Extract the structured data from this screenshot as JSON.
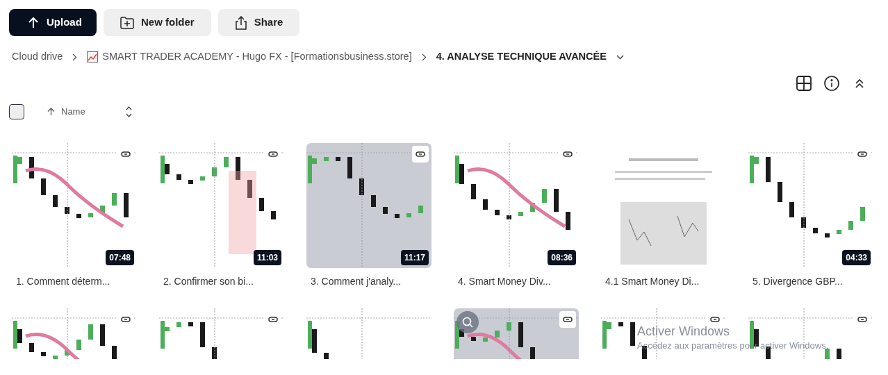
{
  "toolbar": [
    {
      "kind": "upload",
      "label": "Upload"
    },
    {
      "kind": "new_folder",
      "label": "New folder"
    },
    {
      "kind": "share",
      "label": "Share"
    }
  ],
  "breadcrumb": [
    {
      "kind": "root",
      "label": "Cloud drive"
    },
    {
      "kind": "folder",
      "label": "SMART TRADER ACADEMY - Hugo FX - [Formationsbusiness.store]"
    },
    {
      "kind": "current",
      "label": "4. ANALYSE TECHNIQUE AVANCÉE"
    }
  ],
  "sort": {
    "select_all_checked": false,
    "column": "Name",
    "ascending": true
  },
  "items": [
    {
      "name": "1. Comment déterm...",
      "duration": "07:48",
      "link": true,
      "zoom": false
    },
    {
      "name": "2. Confirmer son bi...",
      "duration": "11:03",
      "link": true,
      "zoom": false
    },
    {
      "name": "3. Comment j'analy...",
      "duration": "11:17",
      "link": true,
      "zoom": false
    },
    {
      "name": "4. Smart Money Div...",
      "duration": "08:36",
      "link": true,
      "zoom": false
    },
    {
      "name": "4.1 Smart Money Di...",
      "link": false,
      "zoom": false
    },
    {
      "name": "5. Divergence GBP...",
      "duration": "04:33",
      "link": true,
      "zoom": false
    },
    {
      "link": true,
      "zoom": false
    },
    {
      "link": true,
      "zoom": false
    },
    {
      "link": false,
      "zoom": false
    },
    {
      "link": true,
      "zoom": true
    },
    {
      "link": true,
      "zoom": false
    },
    {
      "link": true,
      "zoom": false
    }
  ],
  "os_notice": {
    "title": "Activer Windows",
    "text": "Accédez aux paramètres pour activer Windows."
  }
}
